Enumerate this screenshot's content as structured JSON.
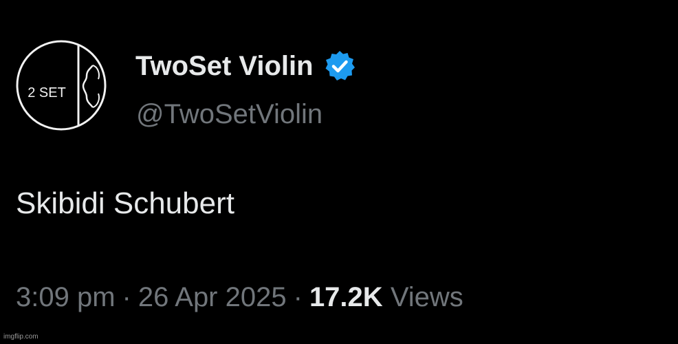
{
  "tweet": {
    "display_name": "TwoSet Violin",
    "handle": "@TwoSetViolin",
    "verified": true,
    "text": "Skibidi Schubert",
    "time": "3:09 pm",
    "date": "26 Apr 2025",
    "separator": "·",
    "views_count": "17.2K",
    "views_label": "Views",
    "avatar": {
      "icon": "twoset-logo-icon",
      "logo_text": "2 SET"
    }
  },
  "watermark": "imgflip.com",
  "colors": {
    "background": "#000000",
    "primary_text": "#e7e9ea",
    "secondary_text": "#71767b",
    "verified_badge": "#1d9bf0"
  }
}
